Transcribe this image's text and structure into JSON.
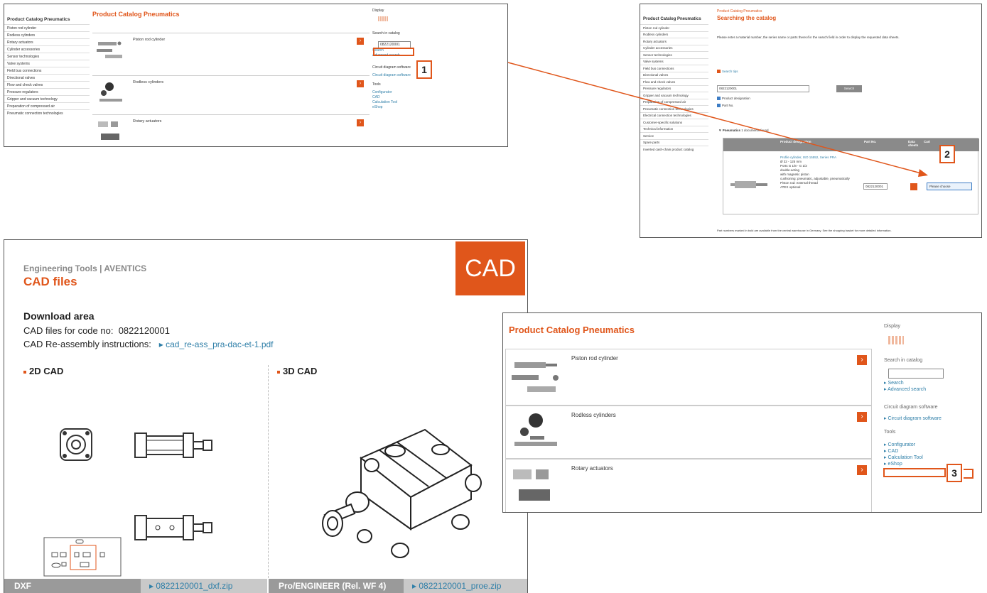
{
  "catalog_small": {
    "title": "Product Catalog Pneumatics",
    "nav_header": "Product Catalog Pneumatics",
    "nav_items": [
      "Piston rod cylinder",
      "Rodless cylinders",
      "Rotary actuators",
      "Cylinder accessories",
      "Sensor technologies",
      "Valve systems",
      "Field bus connections",
      "Directional valves",
      "Flow and check valves",
      "Pressure regulators",
      "Gripper and vacuum technology",
      "Preparation of compressed air",
      "Pneumatic connection technologies"
    ],
    "products": [
      "Piston rod cylinder",
      "Rodless cylinders",
      "Rotary actuators"
    ],
    "display_label": "Display",
    "search_label": "Search in catalog",
    "search_value": "0822120001",
    "links_search": [
      "Search",
      "Advanced search"
    ],
    "circuit_label": "Circuit diagram software",
    "circuit_link": "Circuit diagram software",
    "tools_label": "Tools",
    "tools_links": [
      "Configurator",
      "CAD",
      "Calculation Tool",
      "eShop"
    ]
  },
  "search_result": {
    "breadcrumb": "Product Catalog Pneumatics",
    "heading": "Searching the catalog",
    "intro": "Please enter a material number, the series name or parts thereof in the search field in order to display the requested data sheets.",
    "nav_header": "Product Catalog Pneumatics",
    "nav_items": [
      "Piston rod cylinder",
      "Rodless cylinders",
      "Rotary actuators",
      "Cylinder accessories",
      "Sensor technologies",
      "Valve systems",
      "Field bus connections",
      "Directional valves",
      "Flow and check valves",
      "Pressure regulators",
      "Gripper and vacuum technology",
      "Preparation of compressed air",
      "Pneumatic connection technologies",
      "Electrical connection technologies",
      "Customer-specific solutions",
      "Technical information",
      "Service",
      "Spare parts",
      "Inverted cash-chain product catalog"
    ],
    "tips": "Search tips",
    "search_value": "0822120001",
    "search_button": "Search",
    "check_product": "Product designation",
    "check_part": "Part No.",
    "result_label": "Pneumatics",
    "result_count": "1 documents found",
    "col_designation": "Product designation",
    "col_part": "Part No.",
    "col_data": "Data sheets",
    "col_cart": "Cart",
    "product_name": "Profile cylinder, ISO 15552, Series PRA",
    "product_specs": [
      "Ø 32 - 125 mm",
      "Ports G 1/8 - G 1/2",
      "double-acting",
      "with magnetic piston",
      "cushioning: pneumatic, adjustable, pneumatically",
      "Piston rod: external thread",
      "ATEX optional"
    ],
    "part_no": "0822120001",
    "cart_button": "Please choose",
    "footer": "Part numbers marked in bold are available from the central warehouse in Germany. See the shopping basket for more detailed information."
  },
  "cad": {
    "eyebrow": "Engineering Tools | AVENTICS",
    "title": "CAD files",
    "badge": "CAD",
    "download_heading": "Download area",
    "code_label": "CAD files for code no:",
    "code_value": "0822120001",
    "reassembly_label": "CAD Re-assembly instructions:",
    "reassembly_link": "cad_re-ass_pra-dac-et-1.pdf",
    "section_2d": "2D CAD",
    "section_3d": "3D CAD",
    "format_2d": "DXF",
    "file_2d": "0822120001_dxf.zip",
    "format_3d": "Pro/ENGINEER (Rel. WF 4)",
    "file_3d": "0822120001_proe.zip"
  },
  "catalog_large": {
    "title": "Product Catalog Pneumatics",
    "products": [
      "Piston rod cylinder",
      "Rodless cylinders",
      "Rotary actuators"
    ],
    "display_label": "Display",
    "search_label": "Search in catalog",
    "links_search": [
      "Search",
      "Advanced search"
    ],
    "circuit_label": "Circuit diagram software",
    "circuit_link": "Circuit diagram software",
    "tools_label": "Tools",
    "tools_links": [
      "Configurator",
      "CAD",
      "Calculation Tool",
      "eShop"
    ]
  },
  "callouts": {
    "one": "1",
    "two": "2",
    "three": "3"
  },
  "colors": {
    "accent": "#e0561b",
    "link": "#2f7fa8",
    "bar": "#9a9a9a"
  }
}
